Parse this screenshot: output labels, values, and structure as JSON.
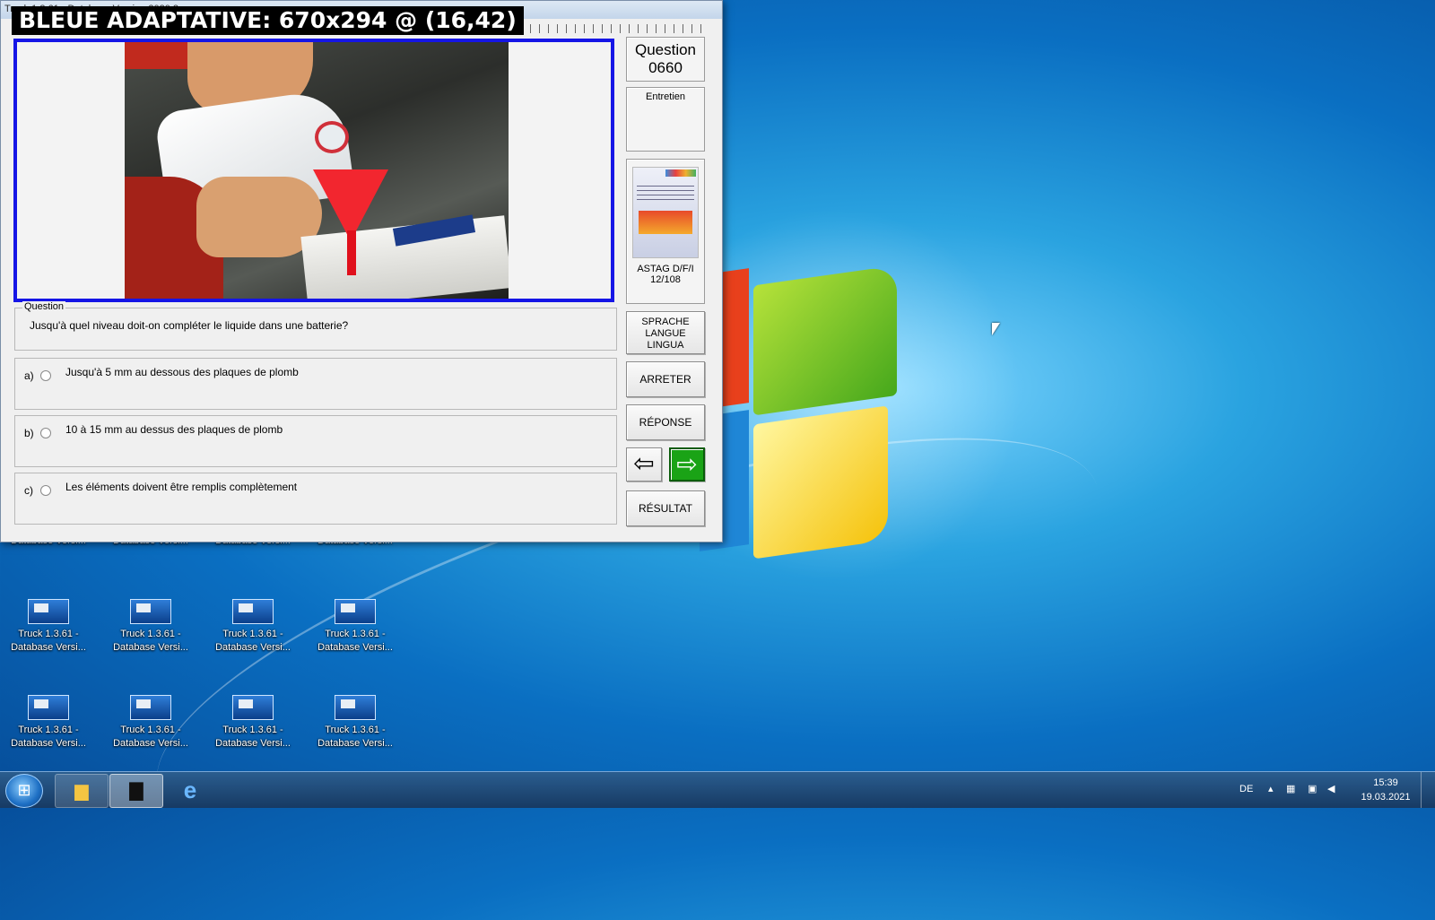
{
  "window": {
    "title": "Truck 1.3.61 - Database Version 2020.2",
    "overlay_label": "BLEUE ADAPTATIVE: 670x294 @ (16,42)"
  },
  "sidebar": {
    "question_label": "Question",
    "question_number": "0660",
    "category": "Entretien",
    "source": "ASTAG D/F/I",
    "source_page": "12/108"
  },
  "question": {
    "legend": "Question",
    "text": "Jusqu'à quel niveau doit-on compléter le liquide dans une batterie?"
  },
  "answers": [
    {
      "letter": "a)",
      "text": "Jusqu'à 5 mm au dessous des plaques de plomb"
    },
    {
      "letter": "b)",
      "text": "10 à 15 mm au dessus des plaques de plomb"
    },
    {
      "letter": "c)",
      "text": "Les éléments doivent être remplis complètement"
    }
  ],
  "buttons": {
    "language": [
      "SPRACHE",
      "LANGUE",
      "LINGUA"
    ],
    "stop": "ARRETER",
    "answer": "RÉPONSE",
    "result": "RÉSULTAT",
    "prev_icon": "arrow-left-icon",
    "next_icon": "arrow-right-icon"
  },
  "desktop_icons": [
    {
      "l1": "",
      "l2": "Database Versi..."
    },
    {
      "l1": "",
      "l2": "Database Versi..."
    },
    {
      "l1": "",
      "l2": "Database Versi..."
    },
    {
      "l1": "",
      "l2": "Database Versi..."
    },
    {
      "l1": "Truck 1.3.61 -",
      "l2": "Database Versi..."
    },
    {
      "l1": "Truck 1.3.61 -",
      "l2": "Database Versi..."
    },
    {
      "l1": "Truck 1.3.61 -",
      "l2": "Database Versi..."
    },
    {
      "l1": "Truck 1.3.61 -",
      "l2": "Database Versi..."
    },
    {
      "l1": "Truck 1.3.61 -",
      "l2": "Database Versi..."
    },
    {
      "l1": "Truck 1.3.61 -",
      "l2": "Database Versi..."
    },
    {
      "l1": "Truck 1.3.61 -",
      "l2": "Database Versi..."
    },
    {
      "l1": "Truck 1.3.61 -",
      "l2": "Database Versi..."
    }
  ],
  "taskbar": {
    "language": "DE",
    "time": "15:39",
    "date": "19.03.2021"
  },
  "colors": {
    "image_frame": "#1515e6",
    "next_button": "#1aa316"
  }
}
